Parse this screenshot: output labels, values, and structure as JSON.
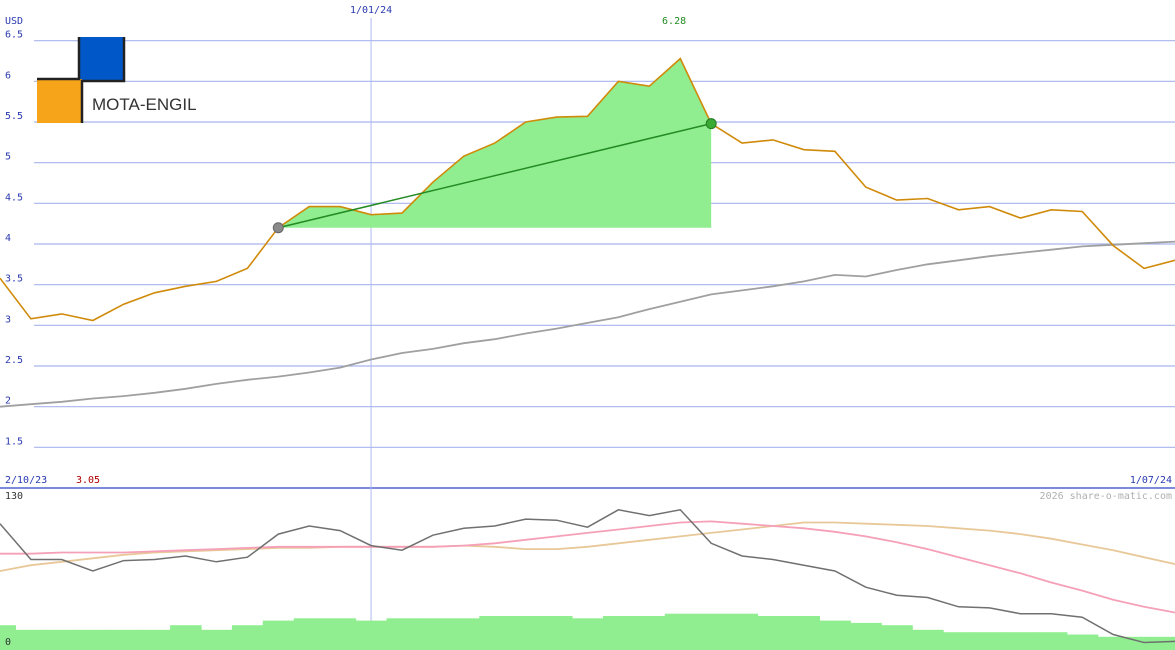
{
  "chart_data": {
    "type": "line",
    "currency_label": "USD",
    "watermark": "2026 share-o-matic.com",
    "brand": {
      "name": "MOTA-ENGIL",
      "blue": "#0057c8",
      "orange": "#f6a51a"
    },
    "colors": {
      "price": "#d08a0a",
      "trend": "#a0a0a0",
      "highlight_fill": "#90ee90",
      "highlight_line": "#228b22",
      "grid": "#a8b4ec",
      "axis_text": "#2a3ab0",
      "vline": "#b0b8f0",
      "sep": "#7a8adc",
      "max_label": "#228b22",
      "min_label": "#b00000",
      "osc_main": "#707070",
      "osc_pink": "#f5a0b8",
      "osc_tan": "#e8c898",
      "volume": "#90ee90"
    },
    "main": {
      "ylim": [
        1.0,
        7.0
      ],
      "yticks": [
        "6.5",
        "6",
        "5.5",
        "5",
        "4.5",
        "4",
        "3.5",
        "3",
        "2.5",
        "2",
        "1.5"
      ],
      "grid_levels": [
        6.5,
        6,
        5.5,
        5,
        4.5,
        4,
        3.5,
        3,
        2.5,
        2,
        1.5
      ],
      "x_range": [
        0,
        38
      ],
      "start_date": "2/10/23",
      "end_date": "1/07/24",
      "mid_date": "1/01/24",
      "mid_x": 12,
      "max_label": "6.28",
      "max_label_x": 21.8,
      "min_label": "3.05",
      "price": [
        3.58,
        3.08,
        3.14,
        3.06,
        3.26,
        3.4,
        3.48,
        3.54,
        3.7,
        4.2,
        4.46,
        4.46,
        4.36,
        4.38,
        4.76,
        5.08,
        5.24,
        5.5,
        5.56,
        5.57,
        6.0,
        5.94,
        6.28,
        5.48,
        5.24,
        5.28,
        5.16,
        5.14,
        4.7,
        4.54,
        4.56,
        4.42,
        4.46,
        4.32,
        4.42,
        4.4,
        3.98,
        3.7,
        3.8
      ],
      "trend": [
        2.0,
        2.03,
        2.06,
        2.1,
        2.13,
        2.17,
        2.22,
        2.28,
        2.33,
        2.37,
        2.42,
        2.48,
        2.58,
        2.66,
        2.71,
        2.78,
        2.83,
        2.9,
        2.96,
        3.03,
        3.1,
        3.2,
        3.29,
        3.38,
        3.43,
        3.48,
        3.54,
        3.62,
        3.6,
        3.68,
        3.75,
        3.8,
        3.85,
        3.89,
        3.93,
        3.97,
        3.99,
        4.01,
        4.03
      ],
      "highlight": {
        "start_index": 9,
        "end_index": 23,
        "base": 4.2
      }
    },
    "oscillator": {
      "ylim": [
        0,
        130
      ],
      "top_label": "130",
      "bottom_label": "0",
      "main": [
        106,
        75,
        75,
        65,
        74,
        75,
        78,
        73,
        77,
        97,
        104,
        100,
        87,
        83,
        96,
        102,
        104,
        110,
        109,
        103,
        118,
        113,
        118,
        89,
        78,
        75,
        70,
        65,
        51,
        44,
        42,
        34,
        33,
        28,
        28,
        25,
        10,
        3,
        4
      ],
      "pink": [
        80,
        80,
        81,
        81,
        81,
        82,
        83,
        84,
        85,
        86,
        86,
        86,
        86,
        86,
        86,
        87,
        89,
        92,
        95,
        98,
        101,
        104,
        107,
        108,
        106,
        104,
        102,
        99,
        95,
        90,
        84,
        77,
        70,
        63,
        55,
        48,
        40,
        34,
        29
      ],
      "tan": [
        65,
        70,
        73,
        76,
        79,
        81,
        82,
        83,
        84,
        85,
        85,
        86,
        86,
        86,
        86,
        87,
        86,
        84,
        84,
        86,
        89,
        92,
        95,
        98,
        101,
        104,
        107,
        107,
        106,
        105,
        104,
        102,
        100,
        97,
        93,
        88,
        83,
        77,
        71
      ],
      "volume": [
        18,
        14,
        14,
        14,
        14,
        14,
        18,
        14,
        18,
        22,
        24,
        24,
        22,
        24,
        24,
        24,
        26,
        26,
        26,
        24,
        26,
        26,
        28,
        28,
        28,
        26,
        26,
        22,
        20,
        18,
        14,
        12,
        12,
        12,
        12,
        10,
        8,
        8,
        8
      ]
    }
  }
}
